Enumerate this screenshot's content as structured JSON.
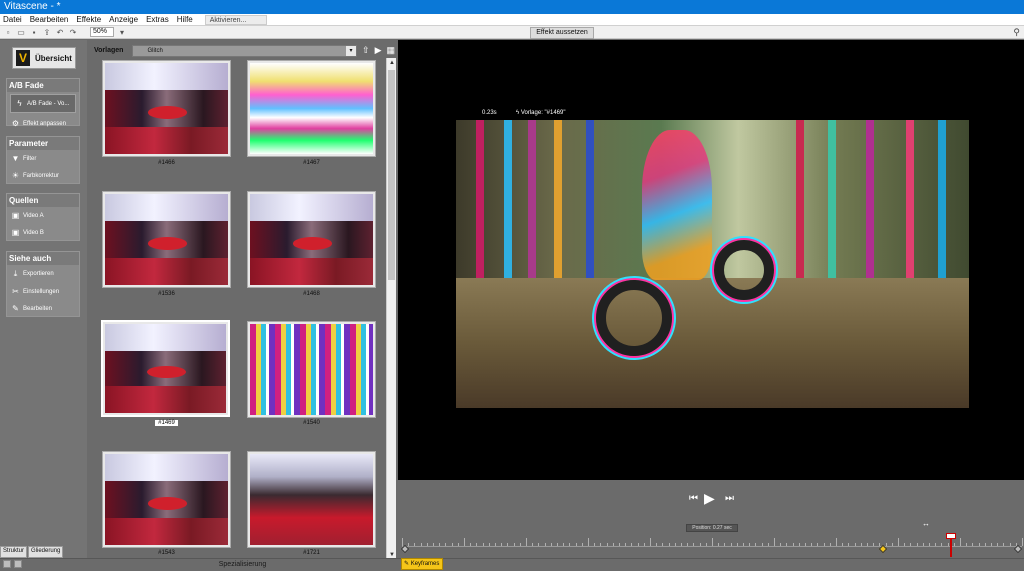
{
  "window": {
    "title": "Vitascene - *"
  },
  "menu": {
    "items": [
      "Datei",
      "Bearbeiten",
      "Effekte",
      "Anzeige",
      "Extras",
      "Hilfe"
    ],
    "activate": "Aktivieren..."
  },
  "toolbar": {
    "zoom": "50%",
    "effect_tab": "Effekt aussetzen"
  },
  "sidebar": {
    "overview": "Übersicht",
    "ab_fade": {
      "title": "A/B Fade",
      "item": "A/B Fade - Vo...",
      "adjust": "Effekt anpassen"
    },
    "parameter": {
      "title": "Parameter",
      "items": [
        "Filter",
        "Farbkorrektur"
      ]
    },
    "quellen": {
      "title": "Quellen",
      "items": [
        "Video A",
        "Video B"
      ]
    },
    "siehe": {
      "title": "Siehe auch",
      "items": [
        "Exportieren",
        "Einstellungen",
        "Bearbeiten"
      ]
    },
    "tabs": [
      "Struktur",
      "Gliederung"
    ]
  },
  "gallery": {
    "label": "Vorlagen",
    "category": "Glitch",
    "tiles": [
      {
        "caption": "#1466"
      },
      {
        "caption": "#1467"
      },
      {
        "caption": "#1536"
      },
      {
        "caption": "#1468"
      },
      {
        "caption": "#1469"
      },
      {
        "caption": "#1540"
      },
      {
        "caption": "#1543"
      },
      {
        "caption": "#1721"
      }
    ],
    "footer": "Spezialisierung"
  },
  "preview": {
    "time": "0.23s",
    "template": "Vorlage: \"#1469\""
  },
  "timeline": {
    "position": "Position: 0.27 sec",
    "keyframes": "Keyframes"
  },
  "colors": {
    "accent": "#0a78d7",
    "playhead": "#cc0000",
    "keyframe": "#f5c518"
  }
}
